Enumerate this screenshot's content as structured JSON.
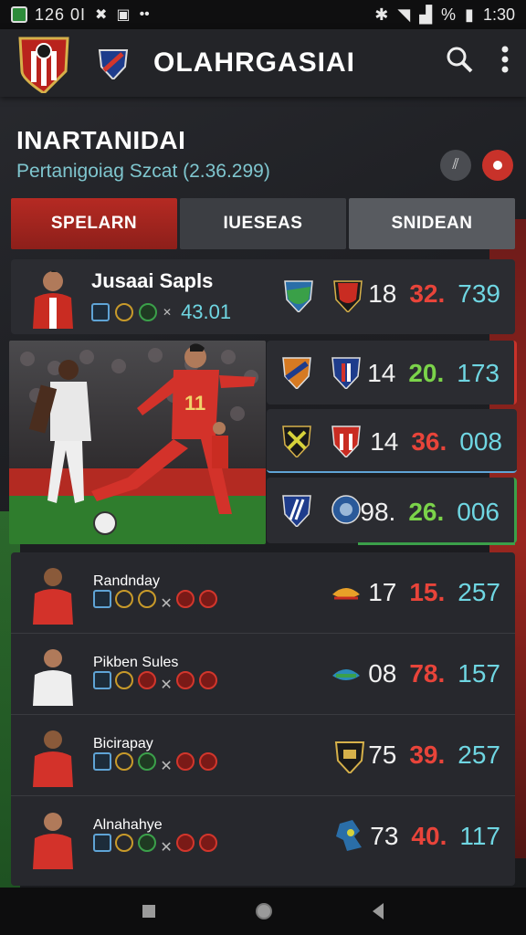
{
  "status_bar": {
    "time_left": "126 0I",
    "percent": "%",
    "time_right": "1:30"
  },
  "app": {
    "title": "OLAHRGASIAI"
  },
  "header": {
    "title": "INARTANIDAI",
    "subtitle": "Pertanigoiag Szcat (2.36.299)"
  },
  "tabs": [
    "SPELARN",
    "IUESEAS",
    "SNIDEAN"
  ],
  "featured_player": {
    "name": "Jusaai Sapls",
    "value": "43.01",
    "stat1": "18",
    "stat2": "32.",
    "stat3": "739"
  },
  "matches": [
    {
      "stat1": "14",
      "stat2": "20.",
      "stat3": "173"
    },
    {
      "stat1": "14",
      "stat2": "36.",
      "stat3": "008"
    },
    {
      "stat1": "98.",
      "stat2": "26.",
      "stat3": "006"
    }
  ],
  "players": [
    {
      "name": "Randnday",
      "stat1": "17",
      "stat2": "15.",
      "stat3": "257"
    },
    {
      "name": "Pikben Sules",
      "stat1": "08",
      "stat2": "78.",
      "stat3": "157"
    },
    {
      "name": "Bicirapay",
      "stat1": "75",
      "stat2": "39.",
      "stat3": "257"
    },
    {
      "name": "Alnahahye",
      "stat1": "73",
      "stat2": "40.",
      "stat3": "117"
    }
  ],
  "colors": {
    "accent_red": "#c8322a",
    "stat_teal": "#6fd6e2",
    "stat_green": "#7bd34a"
  }
}
